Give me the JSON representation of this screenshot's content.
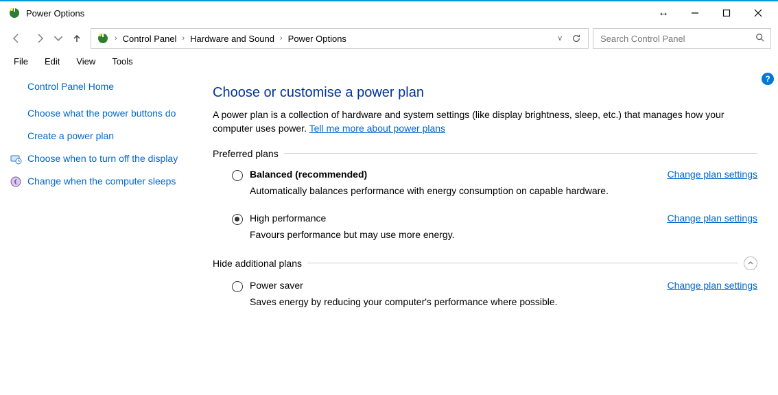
{
  "window": {
    "title": "Power Options"
  },
  "breadcrumb": {
    "seg1": "Control Panel",
    "seg2": "Hardware and Sound",
    "seg3": "Power Options"
  },
  "search": {
    "placeholder": "Search Control Panel"
  },
  "menu": {
    "file": "File",
    "edit": "Edit",
    "view": "View",
    "tools": "Tools"
  },
  "sidebar": {
    "home": "Control Panel Home",
    "links": [
      "Choose what the power buttons do",
      "Create a power plan",
      "Choose when to turn off the display",
      "Change when the computer sleeps"
    ]
  },
  "content": {
    "title": "Choose or customise a power plan",
    "intro_pre": "A power plan is a collection of hardware and system settings (like display brightness, sleep, etc.) that manages how your computer uses power. ",
    "intro_link": "Tell me more about power plans",
    "group1": "Preferred plans",
    "group2": "Hide additional plans",
    "change_link": "Change plan settings",
    "plans": [
      {
        "name": "Balanced (recommended)",
        "desc": "Automatically balances performance with energy consumption on capable hardware.",
        "selected": false,
        "bold": true
      },
      {
        "name": "High performance",
        "desc": "Favours performance but may use more energy.",
        "selected": true,
        "bold": false
      },
      {
        "name": "Power saver",
        "desc": "Saves energy by reducing your computer's performance where possible.",
        "selected": false,
        "bold": false
      }
    ]
  }
}
